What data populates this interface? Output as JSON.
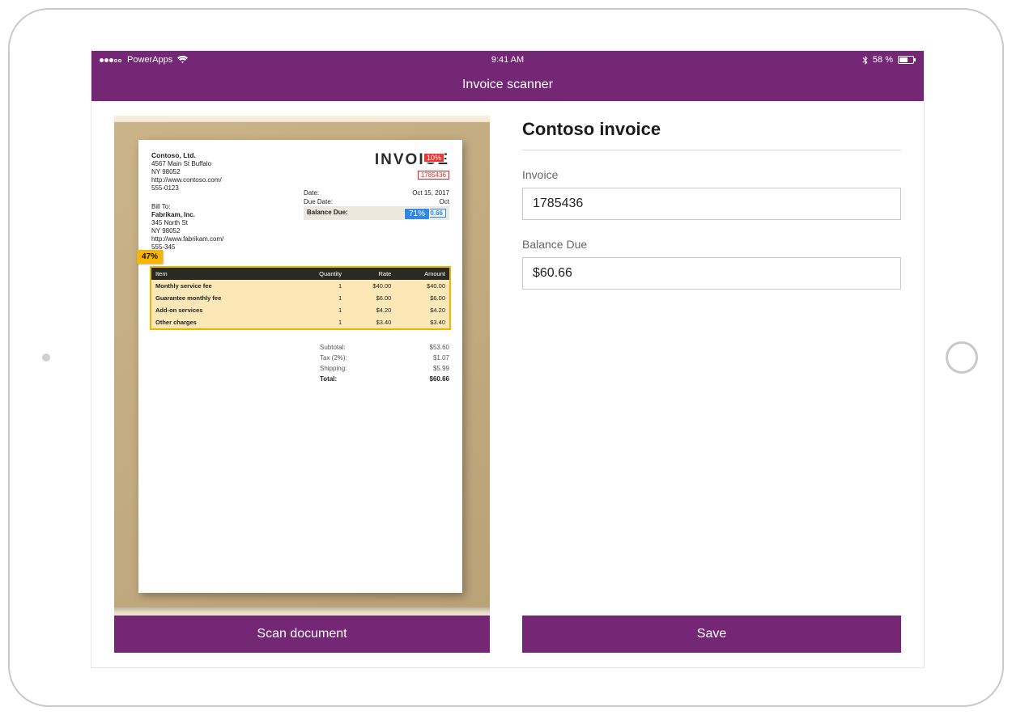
{
  "status_bar": {
    "carrier": "PowerApps",
    "time": "9:41 AM",
    "battery_text": "58 %"
  },
  "app_header": {
    "title": "Invoice scanner"
  },
  "left_panel": {
    "scan_button_label": "Scan document",
    "ocr_badges": {
      "title": "10%",
      "due_date": "71%",
      "table": "47%"
    },
    "invoice_doc": {
      "sender": {
        "company": "Contoso, Ltd.",
        "address1": "4567 Main St Buffalo",
        "address2": "NY 98052",
        "website": "http://www.contoso.com/",
        "phone": "555-0123"
      },
      "title": "INVOICE",
      "invoice_number": "1785436",
      "meta": {
        "date_label": "Date:",
        "date_value": "Oct 15, 2017",
        "due_label": "Due Date:",
        "due_value": "Oct",
        "balance_label": "Balance Due:",
        "balance_value": "$ 60.66"
      },
      "bill_to": {
        "heading": "Bill To:",
        "company": "Fabrikam, Inc.",
        "address1": "345 North St",
        "address2": "NY 98052",
        "website": "http://www.fabrikam.com/",
        "phone": "555-345"
      },
      "table": {
        "headers": {
          "item": "Item",
          "qty": "Quantity",
          "rate": "Rate",
          "amount": "Amount"
        },
        "rows": [
          {
            "item": "Monthly service fee",
            "qty": "1",
            "rate": "$40.00",
            "amount": "$40.00"
          },
          {
            "item": "Guarantee monthly fee",
            "qty": "1",
            "rate": "$6.00",
            "amount": "$6.00"
          },
          {
            "item": "Add-on services",
            "qty": "1",
            "rate": "$4.20",
            "amount": "$4.20"
          },
          {
            "item": "Other charges",
            "qty": "1",
            "rate": "$3.40",
            "amount": "$3.40"
          }
        ]
      },
      "totals": {
        "subtotal_label": "Subtotal:",
        "subtotal_value": "$53.60",
        "tax_label": "Tax (2%):",
        "tax_value": "$1.07",
        "shipping_label": "Shipping:",
        "shipping_value": "$5.99",
        "total_label": "Total:",
        "total_value": "$60.66"
      }
    }
  },
  "right_panel": {
    "heading": "Contoso invoice",
    "fields": {
      "invoice_label": "Invoice",
      "invoice_value": "1785436",
      "balance_label": "Balance Due",
      "balance_value": "$60.66"
    },
    "save_button_label": "Save"
  }
}
